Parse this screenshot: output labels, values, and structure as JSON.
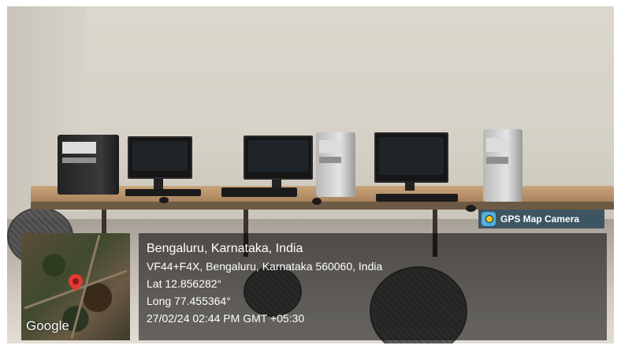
{
  "badge": {
    "label": "GPS Map Camera",
    "icon": "gps-map-camera-icon"
  },
  "map": {
    "attribution": "Google",
    "pin": "location-pin-icon"
  },
  "location": {
    "city": "Bengaluru, Karnataka, India",
    "address": "VF44+F4X, Bengaluru, Karnataka 560060, India",
    "lat": "Lat 12.856282°",
    "long": "Long 77.455364°",
    "datetime": "27/02/24 02:44 PM GMT +05:30"
  },
  "colors": {
    "overlay": "#000000",
    "badge_bg": "#3d5563",
    "pin": "#e53935"
  }
}
